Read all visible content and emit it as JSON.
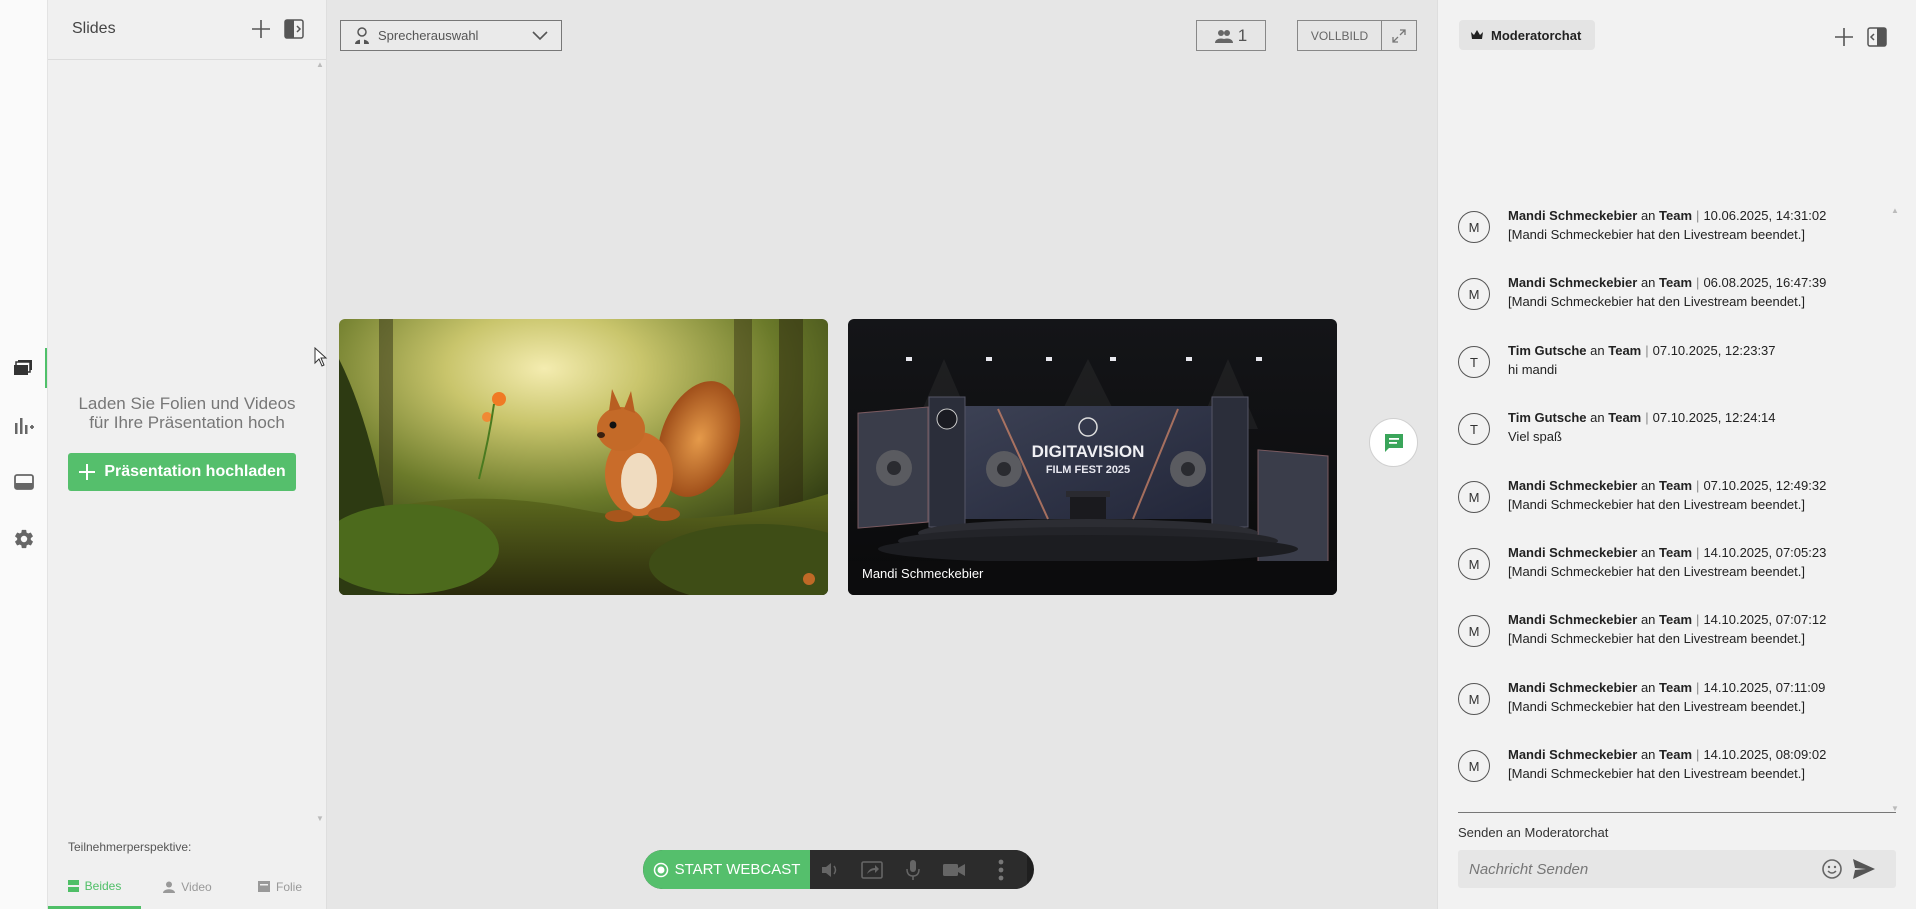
{
  "slides": {
    "title": "Slides",
    "empty_text_1": "Laden Sie Folien und Videos",
    "empty_text_2": "für Ihre Präsentation hoch",
    "upload_label": "Präsentation hochladen",
    "perspective_label": "Teilnehmerperspektive:",
    "perspective_tabs": [
      {
        "label": "Beides",
        "icon": "layers-icon",
        "active": true
      },
      {
        "label": "Video",
        "icon": "person-icon",
        "active": false
      },
      {
        "label": "Folie",
        "icon": "slide-icon",
        "active": false
      }
    ]
  },
  "rail": {
    "items": [
      {
        "icon": "slides-icon",
        "active": true
      },
      {
        "icon": "poll-icon",
        "active": false
      },
      {
        "icon": "banner-icon",
        "active": false
      },
      {
        "icon": "gear-icon",
        "active": false
      }
    ]
  },
  "stage": {
    "speaker_select": "Sprecherauswahl",
    "participant_count": "1",
    "fullscreen_label": "VOLLBILD",
    "tile_name": "Mandi Schmeckebier",
    "stage_sign_1": "DIGITAVISION",
    "stage_sign_2": "FILM FEST 2025",
    "start_label": "START WEBCAST"
  },
  "chat": {
    "tab_label": "Moderatorchat",
    "send_to_label": "Senden an Moderatorchat",
    "input_placeholder": "Nachricht Senden",
    "messages": [
      {
        "initial": "M",
        "sender": "Mandi Schmeckebier",
        "to_word": "an",
        "target": "Team",
        "timestamp": "10.06.2025, 14:31:02",
        "text": "[Mandi Schmeckebier hat den Livestream beendet.]"
      },
      {
        "initial": "M",
        "sender": "Mandi Schmeckebier",
        "to_word": "an",
        "target": "Team",
        "timestamp": "06.08.2025, 16:47:39",
        "text": "[Mandi Schmeckebier hat den Livestream beendet.]"
      },
      {
        "initial": "T",
        "sender": "Tim Gutsche",
        "to_word": "an",
        "target": "Team",
        "timestamp": "07.10.2025, 12:23:37",
        "text": "hi mandi"
      },
      {
        "initial": "T",
        "sender": "Tim Gutsche",
        "to_word": "an",
        "target": "Team",
        "timestamp": "07.10.2025, 12:24:14",
        "text": "Viel spaß"
      },
      {
        "initial": "M",
        "sender": "Mandi Schmeckebier",
        "to_word": "an",
        "target": "Team",
        "timestamp": "07.10.2025, 12:49:32",
        "text": "[Mandi Schmeckebier hat den Livestream beendet.]"
      },
      {
        "initial": "M",
        "sender": "Mandi Schmeckebier",
        "to_word": "an",
        "target": "Team",
        "timestamp": "14.10.2025, 07:05:23",
        "text": "[Mandi Schmeckebier hat den Livestream beendet.]"
      },
      {
        "initial": "M",
        "sender": "Mandi Schmeckebier",
        "to_word": "an",
        "target": "Team",
        "timestamp": "14.10.2025, 07:07:12",
        "text": "[Mandi Schmeckebier hat den Livestream beendet.]"
      },
      {
        "initial": "M",
        "sender": "Mandi Schmeckebier",
        "to_word": "an",
        "target": "Team",
        "timestamp": "14.10.2025, 07:11:09",
        "text": "[Mandi Schmeckebier hat den Livestream beendet.]"
      },
      {
        "initial": "M",
        "sender": "Mandi Schmeckebier",
        "to_word": "an",
        "target": "Team",
        "timestamp": "14.10.2025, 08:09:02",
        "text": "[Mandi Schmeckebier hat den Livestream beendet.]"
      }
    ]
  },
  "colors": {
    "accent_green": "#55bf6c",
    "toolbar_dark": "#1f1f1f"
  }
}
